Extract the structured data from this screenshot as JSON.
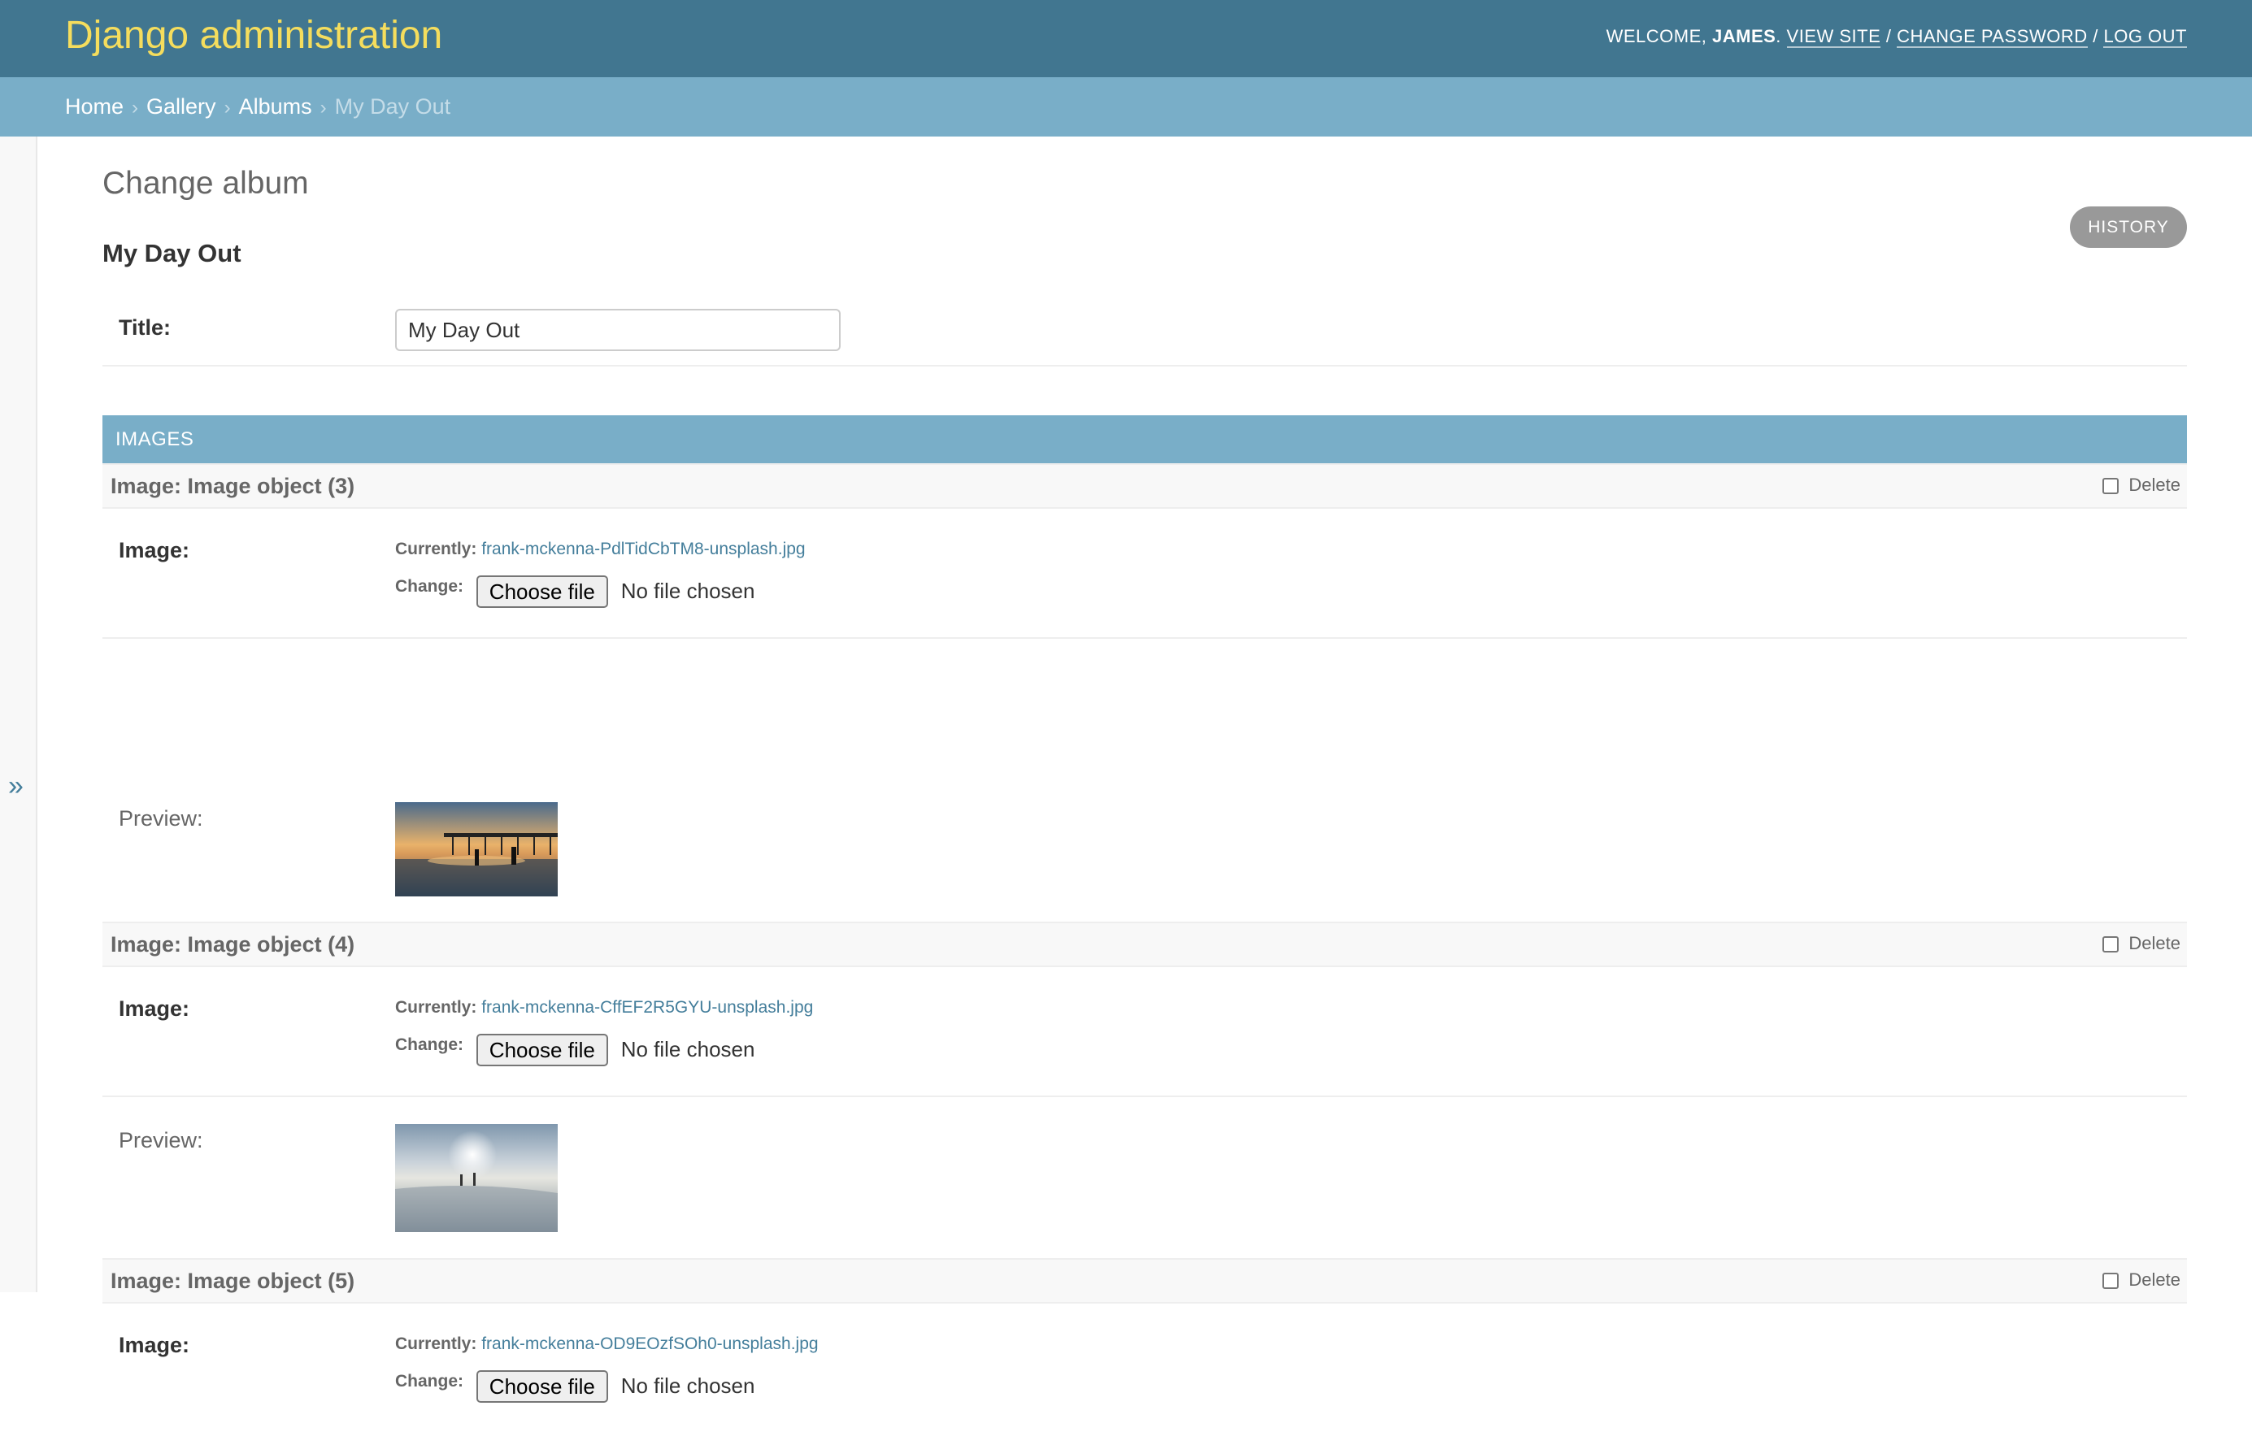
{
  "header": {
    "site_name": "Django administration",
    "welcome": "Welcome,",
    "username": "James",
    "view_site": "View site",
    "change_password": "Change password",
    "log_out": "Log out",
    "separator": "/"
  },
  "breadcrumbs": {
    "items": [
      "Home",
      "Gallery",
      "Albums"
    ],
    "current": "My Day Out",
    "separator": "›"
  },
  "sidebar": {
    "toggle_glyph": "»"
  },
  "page": {
    "title": "Change album",
    "object_title": "My Day Out",
    "history_label": "HISTORY"
  },
  "form": {
    "title_label": "Title:",
    "title_value": "My Day Out"
  },
  "images": {
    "section_label": "IMAGES",
    "image_label": "Image:",
    "preview_label": "Preview:",
    "currently_label": "Currently:",
    "change_label": "Change:",
    "delete_label": "Delete",
    "choose_file_label": "Choose file",
    "no_file_label": "No file chosen",
    "items": [
      {
        "title": "Image: Image object (3)",
        "filename": "frank-mckenna-PdlTidCbTM8-unsplash.jpg"
      },
      {
        "title": "Image: Image object (4)",
        "filename": "frank-mckenna-CffEF2R5GYU-unsplash.jpg"
      },
      {
        "title": "Image: Image object (5)",
        "filename": "frank-mckenna-OD9EOzfSOh0-unsplash.jpg"
      }
    ]
  },
  "colors": {
    "header_bg": "#417690",
    "breadcrumb_bg": "#79aec8",
    "site_name": "#f5dd5d",
    "link": "#447e9b"
  }
}
